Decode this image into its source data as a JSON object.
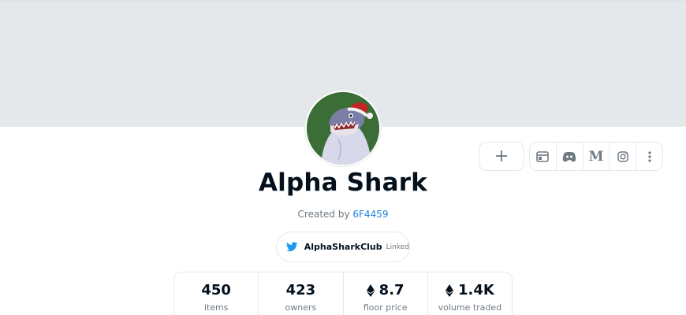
{
  "collection": {
    "name": "Alpha Shark",
    "created_by_prefix": "Created by",
    "creator": "6F4459"
  },
  "actions": {
    "add_label": "+"
  },
  "social_links": [
    {
      "name": "website",
      "icon": "browser-window-icon"
    },
    {
      "name": "discord",
      "icon": "discord-icon"
    },
    {
      "name": "medium",
      "icon": "medium-icon",
      "glyph": "M"
    },
    {
      "name": "instagram",
      "icon": "instagram-icon"
    },
    {
      "name": "more",
      "icon": "more-vertical-icon"
    }
  ],
  "twitter": {
    "handle": "AlphaSharkClub",
    "status": "Linked",
    "icon": "twitter-bird-icon",
    "color": "#1d9bf0"
  },
  "stats": [
    {
      "value": "450",
      "label": "items",
      "eth": false
    },
    {
      "value": "423",
      "label": "owners",
      "eth": false
    },
    {
      "value": "8.7",
      "label": "floor price",
      "eth": true
    },
    {
      "value": "1.4K",
      "label": "volume traded",
      "eth": true
    }
  ],
  "colors": {
    "banner": "#e5e8eb",
    "link": "#2081e2",
    "text_primary": "#04111d",
    "text_secondary": "#707a83",
    "avatar_bg": "#3b6d36"
  }
}
